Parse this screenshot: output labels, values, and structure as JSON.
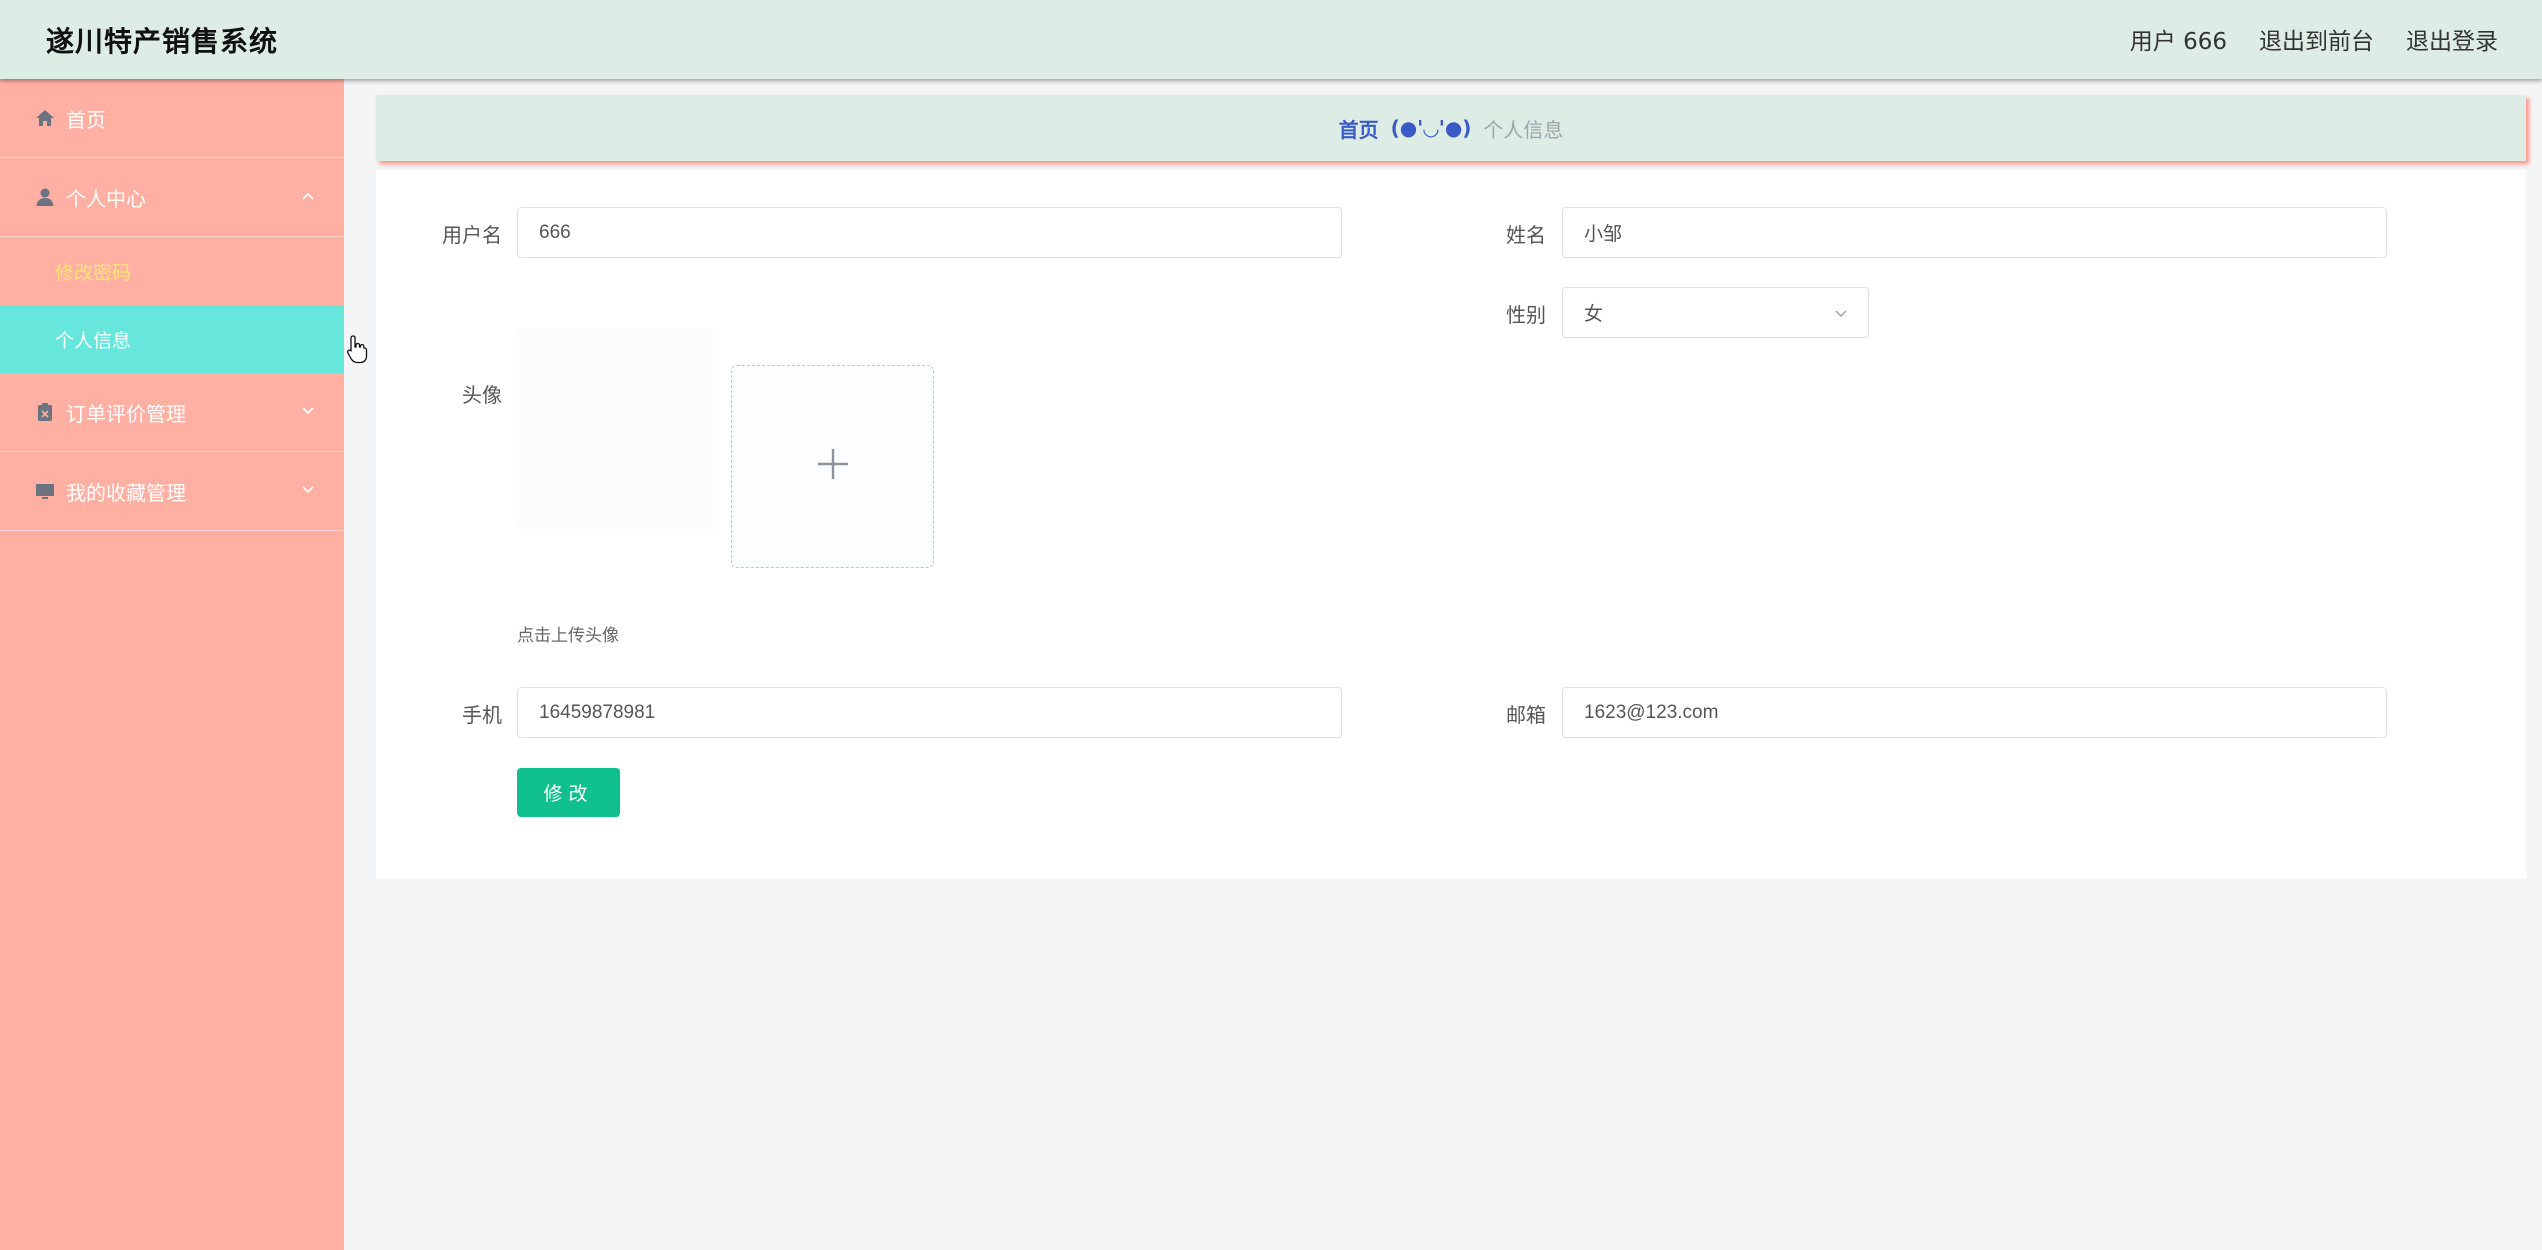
{
  "header": {
    "title": "遂川特产销售系统",
    "user_label": "用户 666",
    "to_front_label": "退出到前台",
    "logout_label": "退出登录"
  },
  "sidebar": {
    "items": [
      {
        "label": "首页",
        "icon": "home-icon"
      },
      {
        "label": "个人中心",
        "icon": "user-icon",
        "expanded": true,
        "children": [
          {
            "label": "修改密码"
          },
          {
            "label": "个人信息",
            "active": true
          }
        ]
      },
      {
        "label": "订单评价管理",
        "icon": "clipboard-icon",
        "expanded": false
      },
      {
        "label": "我的收藏管理",
        "icon": "monitor-icon",
        "expanded": false
      }
    ]
  },
  "breadcrumb": {
    "home": "首页",
    "separator": "(●'◡'●)",
    "current": "个人信息"
  },
  "form": {
    "username_label": "用户名",
    "username_value": "666",
    "name_label": "姓名",
    "name_value": "小邹",
    "gender_label": "性别",
    "gender_value": "女",
    "avatar_label": "头像",
    "upload_hint": "点击上传头像",
    "phone_label": "手机",
    "phone_value": "16459878981",
    "email_label": "邮箱",
    "email_value": "1623@123.com",
    "submit_label": "修改"
  },
  "colors": {
    "header_bg": "#ddede6",
    "sidebar_bg": "#ffb0a2",
    "active_item_bg": "#67e6dc",
    "submit_bg": "#10c08c",
    "breadcrumb_home": "#3a5bc7"
  }
}
